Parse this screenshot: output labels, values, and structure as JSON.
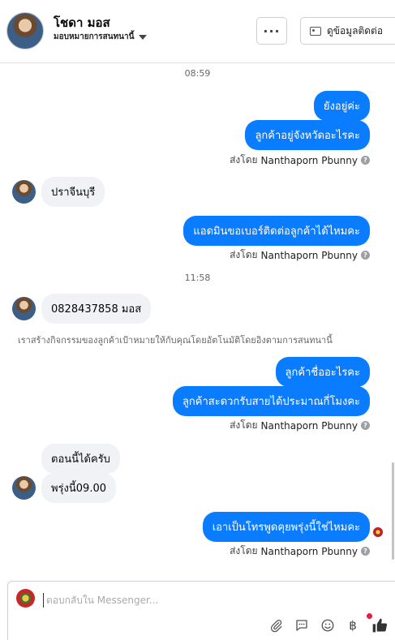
{
  "header": {
    "contact_name": "โชดา มอส",
    "assign_label": "มอบหมายการสนทนานี้",
    "more_label": "···",
    "contact_info_label": "ดูข้อมูลติดต่อ"
  },
  "thread": {
    "time_1": "08:59",
    "time_2": "11:58",
    "messages": [
      {
        "text": "ยังอยู่ค่ะ"
      },
      {
        "text": "ลูกค้าอยู่จังหวัดอะไรคะ"
      },
      {
        "text": "ปราจีนบุรี"
      },
      {
        "text": "แอดมินขอเบอร์ติดต่อลูกค้าได้ไหมคะ"
      },
      {
        "text": "0828437858 มอส"
      },
      {
        "text": "ลูกค้าชื่ออะไรคะ"
      },
      {
        "text": "ลูกค้าสะดวกรับสายได้ประมาณกี่โมงคะ"
      },
      {
        "text": "ตอนนี้ได้ครับ"
      },
      {
        "text": "พรุ่งนี้09.00"
      },
      {
        "text": "เอาเป็นโทรพูดคุยพรุ่งนี้ใช่ไหมคะ"
      }
    ],
    "sent_by_prefix": "ส่งโดย",
    "sent_by_name": "Nanthaporn Pbunny",
    "help_icon": "?",
    "notice": "เราสร้างกิจกรรมของลูกค้าเป้าหมายให้กับคุณโดยอัตโนมัติโดยอิงตามการสนทนานี้"
  },
  "composer": {
    "placeholder": "ตอบกลับใน Messenger...",
    "tools": [
      "paperclip-icon",
      "speech-bubble-icon",
      "smiley-icon",
      "baht-icon",
      "thumbs-up-icon"
    ],
    "baht_symbol": "฿"
  },
  "colors": {
    "outgoing_bubble": "#0a7cff",
    "incoming_bubble": "#f0f2f5",
    "notification_dot": "#e41e3f"
  }
}
